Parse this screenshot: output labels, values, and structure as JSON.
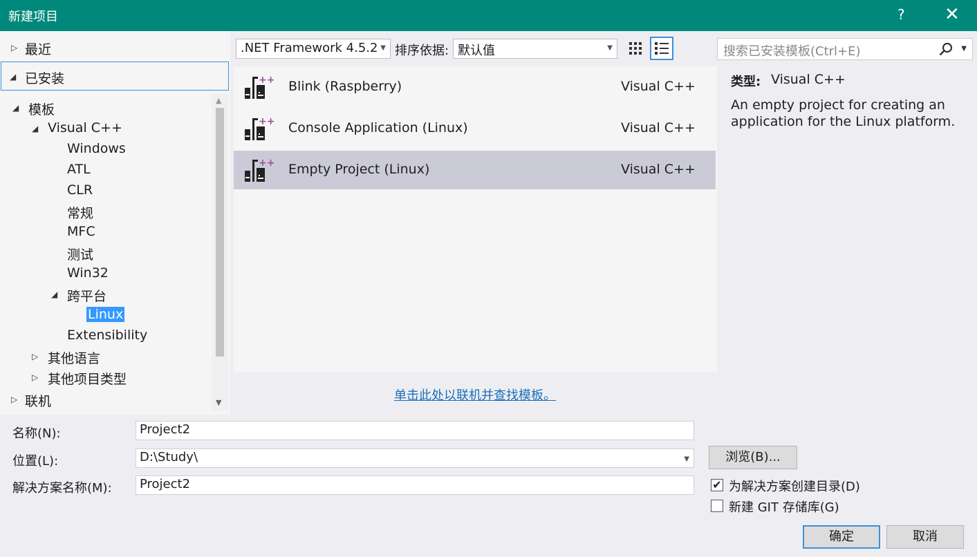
{
  "window": {
    "title": "新建项目",
    "help": "?",
    "close": "✕"
  },
  "left": {
    "recent": "最近",
    "installed": "已安装",
    "tree": [
      {
        "label": "模板",
        "level": 1,
        "expand": "open"
      },
      {
        "label": "Visual C++",
        "level": 2,
        "expand": "open"
      },
      {
        "label": "Windows",
        "level": 3,
        "expand": ""
      },
      {
        "label": "ATL",
        "level": 3,
        "expand": ""
      },
      {
        "label": "CLR",
        "level": 3,
        "expand": ""
      },
      {
        "label": "常规",
        "level": 3,
        "expand": ""
      },
      {
        "label": "MFC",
        "level": 3,
        "expand": ""
      },
      {
        "label": "测试",
        "level": 3,
        "expand": ""
      },
      {
        "label": "Win32",
        "level": 3,
        "expand": ""
      },
      {
        "label": "跨平台",
        "level": 3,
        "expand": "open"
      },
      {
        "label": "Linux",
        "level": 4,
        "expand": "",
        "selected": true
      },
      {
        "label": "Extensibility",
        "level": 3,
        "expand": ""
      },
      {
        "label": "其他语言",
        "level": 2,
        "expand": "closed"
      },
      {
        "label": "其他项目类型",
        "level": 2,
        "expand": "closed"
      }
    ],
    "online": "联机"
  },
  "toolbar": {
    "framework": ".NET Framework 4.5.2",
    "sort_label": "排序依据:",
    "sort_value": "默认值",
    "search_placeholder": "搜索已安装模板(Ctrl+E)"
  },
  "templates": [
    {
      "name": "Blink (Raspberry)",
      "lang": "Visual C++",
      "selected": false
    },
    {
      "name": "Console Application (Linux)",
      "lang": "Visual C++",
      "selected": false
    },
    {
      "name": "Empty Project (Linux)",
      "lang": "Visual C++",
      "selected": true
    }
  ],
  "description": {
    "type_label": "类型:",
    "type_value": "Visual C++",
    "text": "An empty project for creating an application for the Linux platform."
  },
  "online_link": "单击此处以联机并查找模板。",
  "form": {
    "name_label": "名称(N):",
    "name_value": "Project2",
    "location_label": "位置(L):",
    "location_value": "D:\\Study\\",
    "solution_label": "解决方案名称(M):",
    "solution_value": "Project2",
    "browse": "浏览(B)...",
    "create_dir": "为解决方案创建目录(D)",
    "create_dir_checked": true,
    "git": "新建 GIT 存储库(G)",
    "git_checked": false,
    "ok": "确定",
    "cancel": "取消"
  }
}
